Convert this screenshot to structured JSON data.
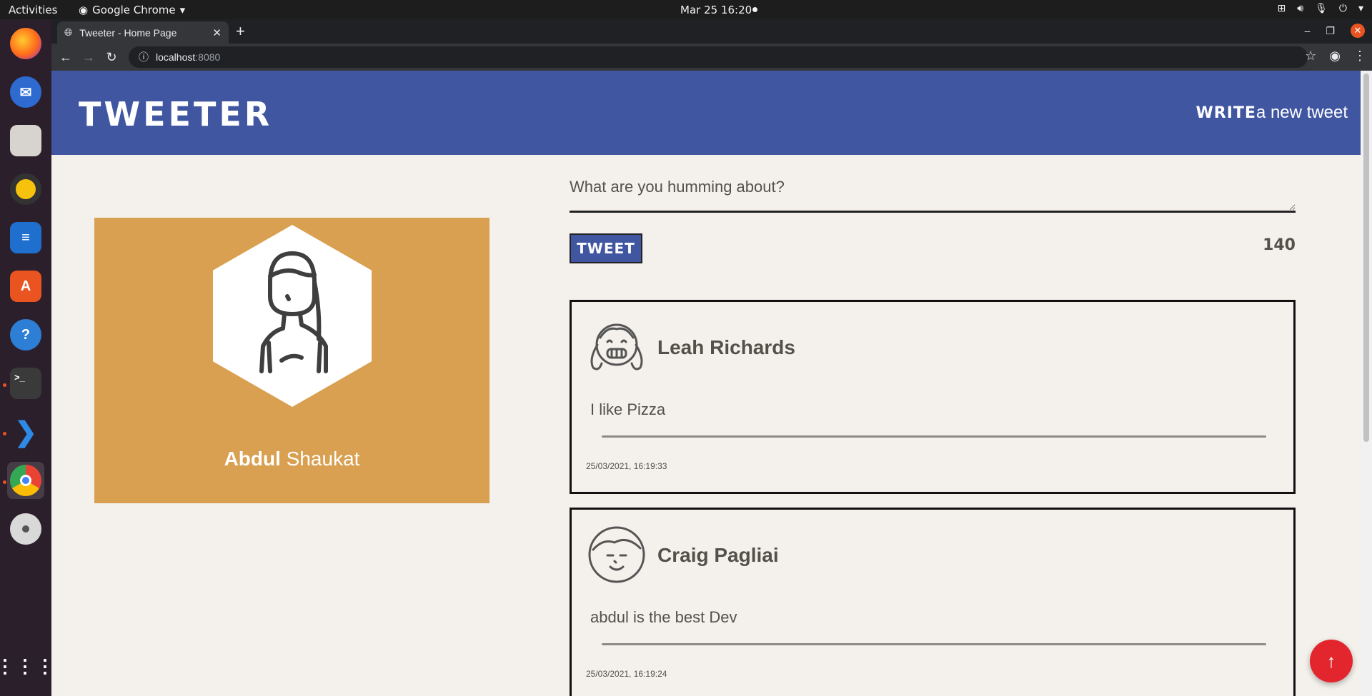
{
  "system": {
    "activities": "Activities",
    "app_menu": "Google Chrome",
    "clock": "Mar 25  16:20"
  },
  "dock": {
    "items": [
      "firefox-icon",
      "thunderbird-icon",
      "files-icon",
      "rhythmbox-icon",
      "writer-icon",
      "app-center-icon",
      "help-icon",
      "terminal-icon",
      "vscode-icon",
      "chrome-icon",
      "disc-icon",
      "app-grid-icon"
    ]
  },
  "browser": {
    "tab_title": "Tweeter - Home Page",
    "url_host": "localhost",
    "url_port": ":8080"
  },
  "page": {
    "brand": "Tweeter",
    "write_bold": "Write",
    "write_rest": "a new tweet",
    "profile": {
      "first": "Abdul",
      "last": "Shaukat"
    },
    "composer": {
      "placeholder": "What are you humming about?",
      "button": "Tweet",
      "counter": "140"
    },
    "tweets": [
      {
        "author": "Leah Richards",
        "text": "I like Pizza",
        "time": "25/03/2021, 16:19:33"
      },
      {
        "author": "Craig Pagliai",
        "text": "abdul is the best Dev",
        "time": "25/03/2021, 16:19:24"
      }
    ],
    "scroll_top_icon": "arrow-up-icon"
  },
  "colors": {
    "header": "#4056a1",
    "background": "#f4f1ec",
    "profile_card": "#d8a050",
    "text": "#545149",
    "scroll_button": "#e3262e"
  }
}
